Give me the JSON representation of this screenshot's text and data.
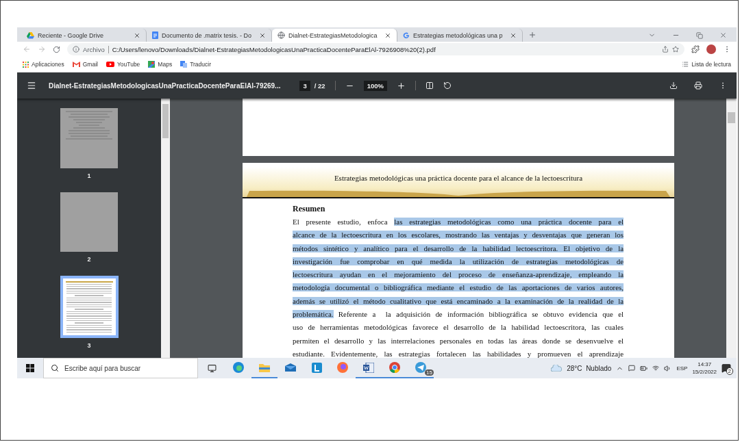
{
  "tabs": [
    {
      "title": "Reciente - Google Drive",
      "kind": "drive",
      "selected": false
    },
    {
      "title": "Documento de .matrix tesis. - Do",
      "kind": "docs",
      "selected": false
    },
    {
      "title": "Dialnet-EstrategiasMetodologica",
      "kind": "globe",
      "selected": true
    },
    {
      "title": "Estrategias metodológicas una p",
      "kind": "google",
      "selected": false
    }
  ],
  "address_bar": {
    "scheme": "Archivo",
    "url": "C:/Users/lenovo/Downloads/Dialnet-EstrategiasMetodologicasUnaPracticaDocenteParaElAl-7926908%20(2).pdf"
  },
  "bookmarks": [
    {
      "label": "Aplicaciones",
      "kind": "apps"
    },
    {
      "label": "Gmail",
      "kind": "gmail"
    },
    {
      "label": "YouTube",
      "kind": "youtube"
    },
    {
      "label": "Maps",
      "kind": "maps"
    },
    {
      "label": "Traducir",
      "kind": "translate"
    }
  ],
  "reading_list": "Lista de lectura",
  "pdf_toolbar": {
    "title": "Dialnet-EstrategiasMetodologicasUnaPracticaDocenteParaElAl-79269...",
    "page": "3",
    "page_total": "/ 22",
    "zoom": "100%"
  },
  "thumbnails": [
    {
      "label": "1",
      "kind": "cover",
      "selected": false
    },
    {
      "label": "2",
      "kind": "blank",
      "selected": false
    },
    {
      "label": "3",
      "kind": "text",
      "selected": true
    }
  ],
  "page": {
    "header": "Estrategias metodológicas una práctica docente para el alcance de la lectoescritura",
    "heading": "Resumen",
    "lines": [
      [
        {
          "text": "El presente estudio, enfoca ",
          "highlighted": false
        },
        {
          "text": "las estrategias metodológicas como una práctica docente para el",
          "highlighted": true
        }
      ],
      [
        {
          "text": "alcance de la lectoescritura en los escolares, mostrando las ventajas y desventajas que generan los",
          "highlighted": true
        }
      ],
      [
        {
          "text": "métodos sintético y analítico para el desarrollo de la habilidad lectoescritora. El objetivo de la",
          "highlighted": true
        }
      ],
      [
        {
          "text": "investigación fue comprobar en qué medida la utilización de estrategias metodológicas de",
          "highlighted": true
        }
      ],
      [
        {
          "text": "lectoescritura ayudan en el mejoramiento del proceso de enseñanza-aprendizaje, empleando la",
          "highlighted": true
        }
      ],
      [
        {
          "text": "metodología documental o bibliográfica mediante el estudio de las aportaciones de varios autores,",
          "highlighted": true
        }
      ],
      [
        {
          "text": "además se utilizó el método cualitativo que está encaminado a la examinación de la realidad de la",
          "highlighted": true
        }
      ],
      [
        {
          "text": "problemática.",
          "highlighted": true
        },
        {
          "text": " Referente a  la adquisición de información bibliográfica se obtuvo evidencia que el",
          "highlighted": false
        }
      ],
      [
        {
          "text": "uso de herramientas metodológicas favorece el desarrollo de la habilidad lectoescritora, las cuales",
          "highlighted": false
        }
      ],
      [
        {
          "text": "permiten el desarrollo y las interrelaciones personales en todas las áreas donde se desenvuelve el",
          "highlighted": false
        }
      ],
      [
        {
          "text": "estudiante. Evidentemente, las estrategias fortalecen las habilidades y promueven el aprendizaje",
          "highlighted": false
        }
      ]
    ]
  },
  "taskbar": {
    "search_placeholder": "Escribe aquí para buscar",
    "apps": [
      {
        "kind": "edge",
        "running": false
      },
      {
        "kind": "explorer",
        "running": true
      },
      {
        "kind": "mail",
        "running": false
      },
      {
        "kind": "letter",
        "running": false
      },
      {
        "kind": "firefox",
        "running": false
      },
      {
        "kind": "word",
        "running": true
      },
      {
        "kind": "chrome",
        "running": true
      },
      {
        "kind": "telegram",
        "running": true,
        "badge": "15"
      }
    ],
    "weather": "28°C  Nublado",
    "language": "ESP",
    "time": "14:37",
    "date": "15/2/2022",
    "notifications": "2"
  }
}
